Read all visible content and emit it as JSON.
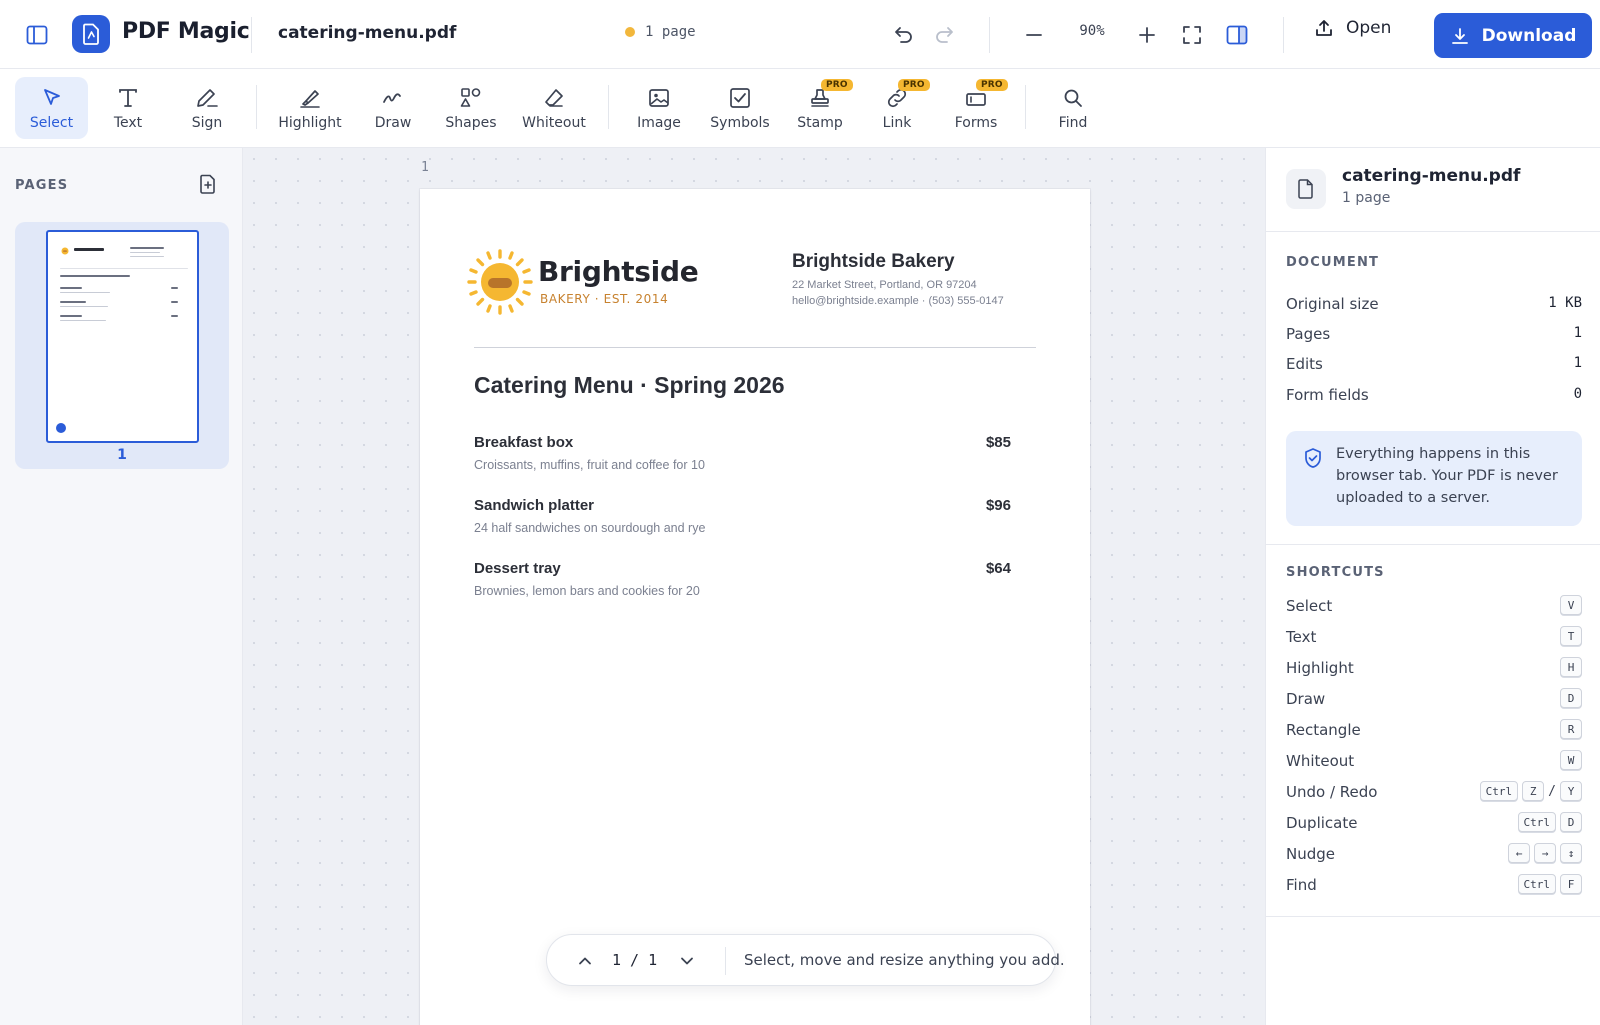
{
  "app": {
    "name": "PDF Magic"
  },
  "header": {
    "file_name": "catering-menu.pdf",
    "page_status": "1 page",
    "zoom": "90%",
    "open_label": "Open",
    "download_label": "Download"
  },
  "toolbar": {
    "tools": [
      {
        "label": "Select",
        "icon": "cursor-icon"
      },
      {
        "label": "Text",
        "icon": "text-icon"
      },
      {
        "label": "Sign",
        "icon": "pen-icon"
      },
      {
        "label": "Highlight",
        "icon": "highlighter-icon"
      },
      {
        "label": "Draw",
        "icon": "squiggle-icon"
      },
      {
        "label": "Shapes",
        "icon": "shapes-icon"
      },
      {
        "label": "Whiteout",
        "icon": "eraser-icon"
      },
      {
        "label": "Image",
        "icon": "image-icon"
      },
      {
        "label": "Symbols",
        "icon": "checkbox-icon"
      },
      {
        "label": "Stamp",
        "icon": "stamp-icon"
      },
      {
        "label": "Link",
        "icon": "link-icon"
      },
      {
        "label": "Forms",
        "icon": "form-icon"
      },
      {
        "label": "Find",
        "icon": "search-icon"
      }
    ],
    "pro_badge": "PRO",
    "active_tool": "Select"
  },
  "pages_panel": {
    "heading": "PAGES",
    "thumb_number": "1"
  },
  "canvas": {
    "page_label": "1"
  },
  "document": {
    "brand_name": "Brightside",
    "brand_sub": "BAKERY · EST. 2014",
    "business_name": "Brightside Bakery",
    "address": "22 Market Street, Portland, OR 97204",
    "contact": "hello@brightside.example · (503) 555-0147",
    "menu_title": "Catering Menu · Spring 2026",
    "items": [
      {
        "name": "Breakfast box",
        "description": "Croissants, muffins, fruit and coffee for 10",
        "price": "$85"
      },
      {
        "name": "Sandwich platter",
        "description": "24 half sandwiches on sourdough and rye",
        "price": "$96"
      },
      {
        "name": "Dessert tray",
        "description": "Brownies, lemon bars and cookies for 20",
        "price": "$64"
      }
    ]
  },
  "pager": {
    "count": "1 / 1",
    "hint": "Select, move and resize anything you add."
  },
  "info_panel": {
    "file_name": "catering-menu.pdf",
    "file_pages": "1 page",
    "document_heading": "DOCUMENT",
    "stats": [
      {
        "label": "Original size",
        "value": "1 KB"
      },
      {
        "label": "Pages",
        "value": "1"
      },
      {
        "label": "Edits",
        "value": "1"
      },
      {
        "label": "Form fields",
        "value": "0"
      }
    ],
    "privacy_note": "Everything happens in this browser tab. Your PDF is never uploaded to a server.",
    "shortcuts_heading": "SHORTCUTS",
    "shortcuts": [
      {
        "label": "Select",
        "keys": [
          "V"
        ]
      },
      {
        "label": "Text",
        "keys": [
          "T"
        ]
      },
      {
        "label": "Highlight",
        "keys": [
          "H"
        ]
      },
      {
        "label": "Draw",
        "keys": [
          "D"
        ]
      },
      {
        "label": "Rectangle",
        "keys": [
          "R"
        ]
      },
      {
        "label": "Whiteout",
        "keys": [
          "W"
        ]
      },
      {
        "label": "Undo / Redo",
        "keys": [
          "Ctrl",
          "Z",
          "/",
          "Y"
        ]
      },
      {
        "label": "Duplicate",
        "keys": [
          "Ctrl",
          "D"
        ]
      },
      {
        "label": "Nudge",
        "keys": [
          "←",
          "→",
          "↕"
        ]
      },
      {
        "label": "Find",
        "keys": [
          "Ctrl",
          "F"
        ]
      }
    ]
  },
  "colors": {
    "accent": "#2b5cd8",
    "accent_soft": "#e7eefc",
    "pro_badge": "#f5b731",
    "brand_orange": "#c7822f",
    "status_dot": "#f2b73c"
  }
}
